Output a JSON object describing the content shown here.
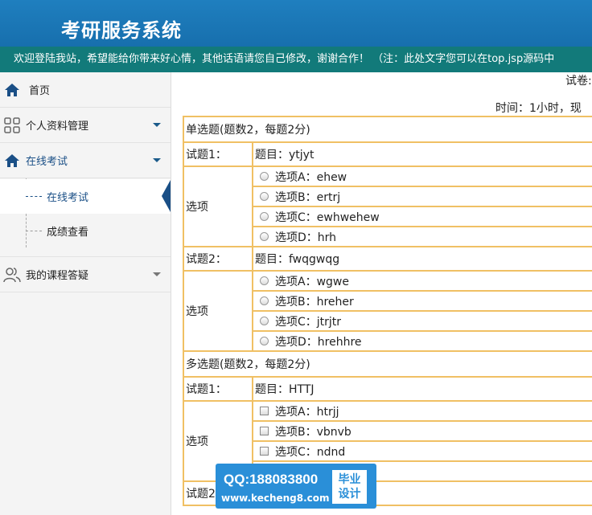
{
  "header": {
    "title": "考研服务系统"
  },
  "notice": "欢迎登陆我站，希望能给你带来好心情，其他话语请您自己修改，谢谢合作！ （注：此处文字您可以在top.jsp源码中",
  "sidebar": {
    "items": [
      {
        "label": "首页",
        "icon": "home-icon"
      },
      {
        "label": "个人资料管理",
        "icon": "grid-icon"
      },
      {
        "label": "在线考试",
        "icon": "home-icon"
      },
      {
        "label": "我的课程答疑",
        "icon": "users-icon"
      }
    ],
    "sub_items": [
      {
        "label": "在线考试"
      },
      {
        "label": "成绩查看"
      }
    ]
  },
  "main": {
    "paper_title": "试卷:",
    "time_text": "时间：1小时，现",
    "single": {
      "header": "单选题(题数2，每题2分)",
      "questions": [
        {
          "label": "试题1：",
          "title": "题目：ytjyt",
          "options_label": "选项",
          "options": [
            "选项A：ehew",
            "选项B：ertrj",
            "选项C：ewhwehew",
            "选项D：hrh"
          ]
        },
        {
          "label": "试题2：",
          "title": "题目：fwqgwqg",
          "options_label": "选项",
          "options": [
            "选项A：wgwe",
            "选项B：hreher",
            "选项C：jtrjtr",
            "选项D：hrehhre"
          ]
        }
      ]
    },
    "multi": {
      "header": "多选题(题数2，每题2分)",
      "questions": [
        {
          "label": "试题1：",
          "title": "题目：HTTJ",
          "options_label": "选项",
          "options": [
            "选项A：htrjj",
            "选项B：vbnvb",
            "选项C：ndnd"
          ]
        }
      ],
      "q2_label": "试题2"
    }
  },
  "watermark": {
    "qq": "QQ:188083800",
    "url": "www.kecheng8.com",
    "badge_line1": "毕业",
    "badge_line2": "设计"
  },
  "colors": {
    "header_bg": "#1f7fbf",
    "notice_bg": "#127a7a",
    "table_border": "#f0c064",
    "accent": "#1a4f86"
  }
}
